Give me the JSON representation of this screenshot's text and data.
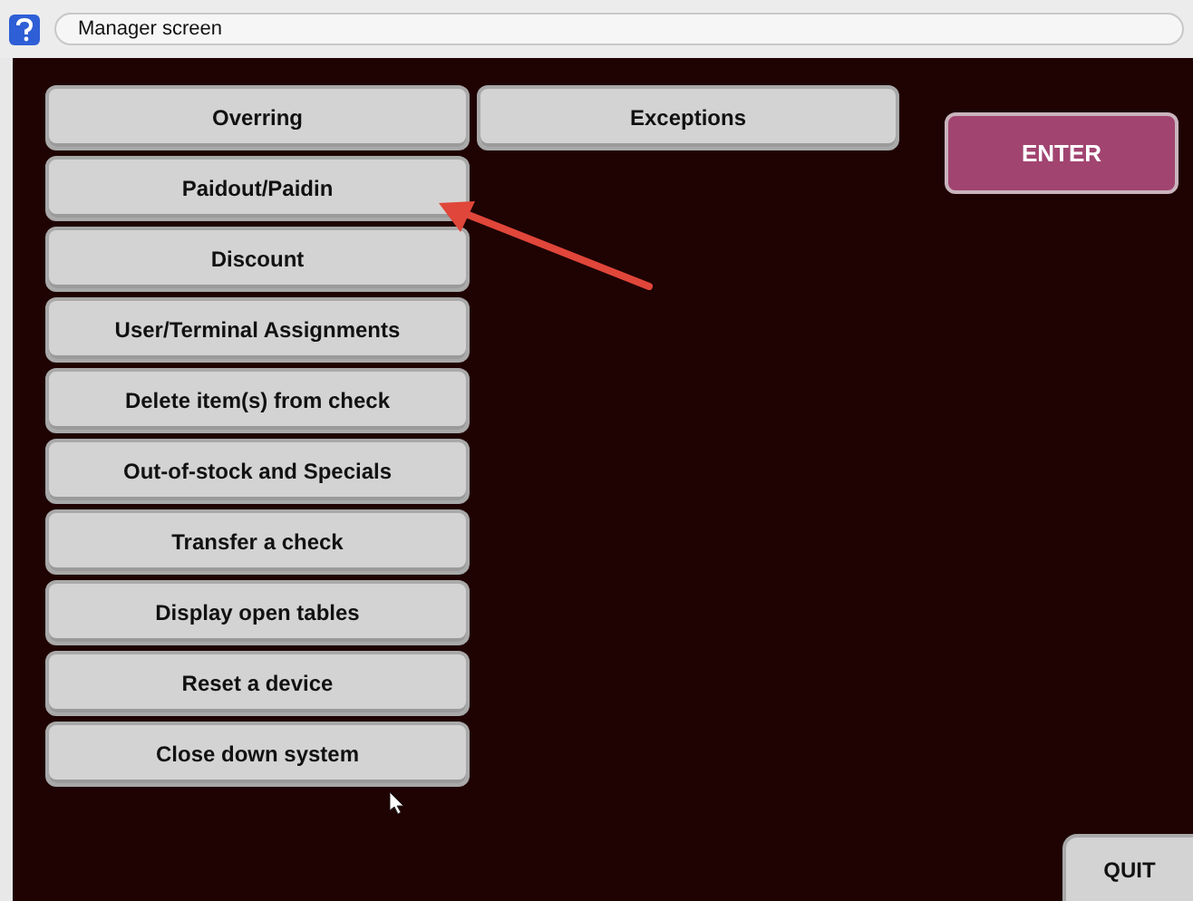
{
  "window": {
    "title": "Manager screen"
  },
  "menu_buttons": [
    {
      "label": "Overring"
    },
    {
      "label": "Paidout/Paidin"
    },
    {
      "label": "Discount"
    },
    {
      "label": "User/Terminal Assignments"
    },
    {
      "label": "Delete item(s) from check"
    },
    {
      "label": "Out-of-stock and Specials"
    },
    {
      "label": "Transfer a check"
    },
    {
      "label": "Display open tables"
    },
    {
      "label": "Reset a device"
    },
    {
      "label": "Close down system"
    }
  ],
  "second_column": [
    {
      "label": "Exceptions"
    }
  ],
  "enter_button": {
    "label": "ENTER"
  },
  "quit_button": {
    "label": "QUIT"
  }
}
